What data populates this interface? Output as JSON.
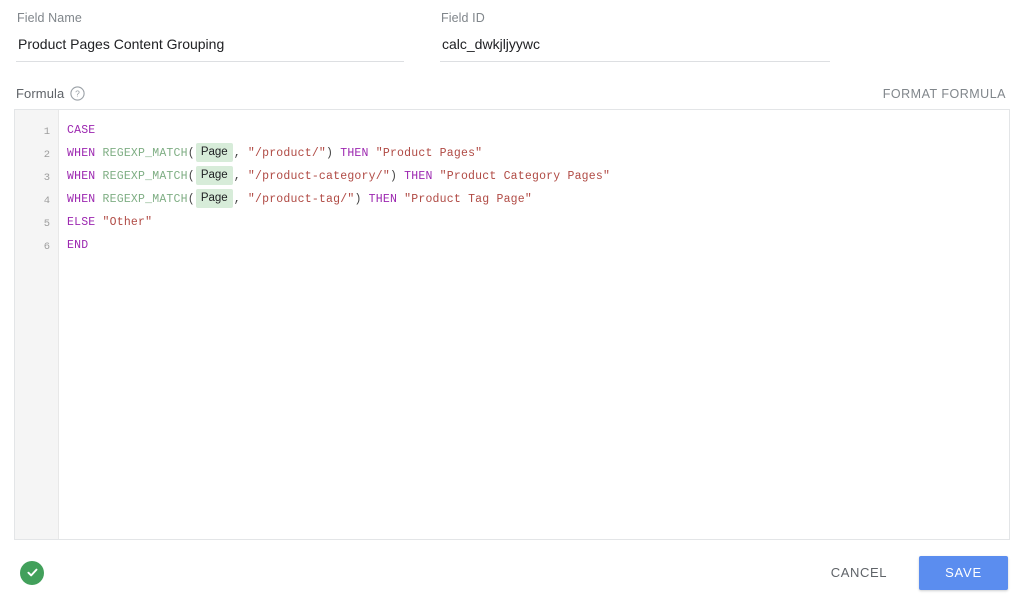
{
  "colors": {
    "accent": "#5b8def",
    "status_ok": "#42a05b",
    "chip_bg": "#d7ecd9",
    "keyword": "#9c27b0",
    "function": "#7fae84",
    "string": "#b04a44"
  },
  "fields": {
    "name": {
      "label": "Field Name",
      "value": "Product Pages Content Grouping",
      "placeholder": "Field Name"
    },
    "id": {
      "label": "Field ID",
      "value": "calc_dwkjljyywc",
      "placeholder": "Field ID"
    }
  },
  "formula_section": {
    "label": "Formula",
    "help_icon": "help-circle-icon",
    "format_button": "FORMAT FORMULA"
  },
  "editor": {
    "line_numbers": [
      "1",
      "2",
      "3",
      "4",
      "5",
      "6"
    ],
    "lines": [
      {
        "number": "1",
        "tokens": [
          {
            "type": "kw",
            "text": "CASE"
          }
        ]
      },
      {
        "number": "2",
        "tokens": [
          {
            "type": "kw",
            "text": "WHEN"
          },
          {
            "type": "plain",
            "text": " "
          },
          {
            "type": "fn",
            "text": "REGEXP_MATCH"
          },
          {
            "type": "punct",
            "text": "("
          },
          {
            "type": "chip",
            "text": "Page"
          },
          {
            "type": "punct",
            "text": ", "
          },
          {
            "type": "str",
            "text": "\"/product/\""
          },
          {
            "type": "punct",
            "text": ") "
          },
          {
            "type": "kw",
            "text": "THEN"
          },
          {
            "type": "plain",
            "text": " "
          },
          {
            "type": "str",
            "text": "\"Product Pages\""
          }
        ]
      },
      {
        "number": "3",
        "tokens": [
          {
            "type": "kw",
            "text": "WHEN"
          },
          {
            "type": "plain",
            "text": " "
          },
          {
            "type": "fn",
            "text": "REGEXP_MATCH"
          },
          {
            "type": "punct",
            "text": "("
          },
          {
            "type": "chip",
            "text": "Page"
          },
          {
            "type": "punct",
            "text": ", "
          },
          {
            "type": "str",
            "text": "\"/product-category/\""
          },
          {
            "type": "punct",
            "text": ") "
          },
          {
            "type": "kw",
            "text": "THEN"
          },
          {
            "type": "plain",
            "text": " "
          },
          {
            "type": "str",
            "text": "\"Product Category Pages\""
          }
        ]
      },
      {
        "number": "4",
        "tokens": [
          {
            "type": "kw",
            "text": "WHEN"
          },
          {
            "type": "plain",
            "text": " "
          },
          {
            "type": "fn",
            "text": "REGEXP_MATCH"
          },
          {
            "type": "punct",
            "text": "("
          },
          {
            "type": "chip",
            "text": "Page"
          },
          {
            "type": "punct",
            "text": ", "
          },
          {
            "type": "str",
            "text": "\"/product-tag/\""
          },
          {
            "type": "punct",
            "text": ") "
          },
          {
            "type": "kw",
            "text": "THEN"
          },
          {
            "type": "plain",
            "text": " "
          },
          {
            "type": "str",
            "text": "\"Product Tag Page\""
          }
        ]
      },
      {
        "number": "5",
        "tokens": [
          {
            "type": "kw",
            "text": "ELSE"
          },
          {
            "type": "plain",
            "text": " "
          },
          {
            "type": "str",
            "text": "\"Other\""
          }
        ]
      },
      {
        "number": "6",
        "tokens": [
          {
            "type": "kw",
            "text": "END"
          }
        ]
      }
    ]
  },
  "footer": {
    "status_icon": "check-circle-icon",
    "cancel_label": "CANCEL",
    "save_label": "SAVE"
  }
}
